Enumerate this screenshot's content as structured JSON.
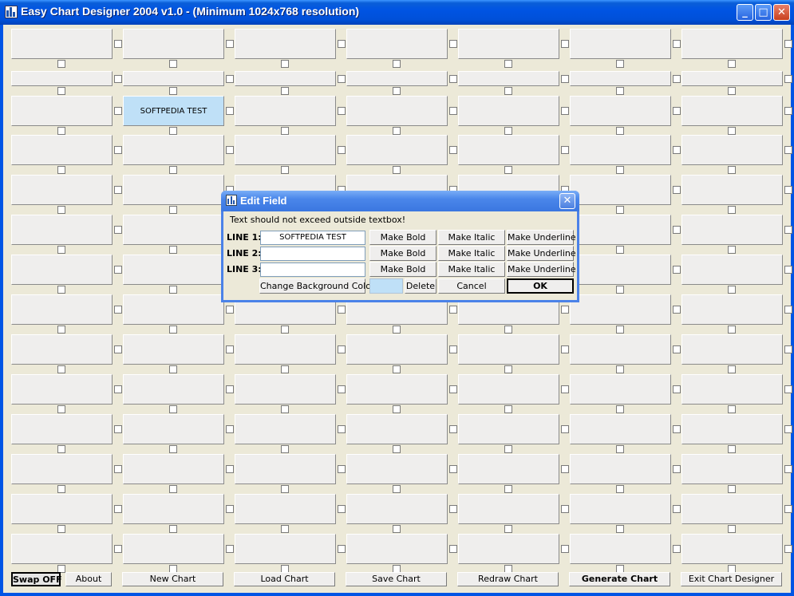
{
  "window": {
    "title": "Easy Chart Designer 2004 v1.0 - (Minimum 1024x768 resolution)",
    "controls": {
      "minimize": "_",
      "maximize": "□",
      "close": "✕"
    }
  },
  "grid": {
    "columns": 7,
    "rows": 13,
    "row_kinds": [
      "normal",
      "thin",
      "normal",
      "normal",
      "normal",
      "normal",
      "normal",
      "normal",
      "normal",
      "normal",
      "normal",
      "normal",
      "normal",
      "normal"
    ],
    "filled_cell": {
      "row": 2,
      "col": 1,
      "text": "SOFTPEDIA TEST",
      "background": "#bfe0f7"
    }
  },
  "bottom_bar": {
    "swap": "Swap OFF",
    "about": "About",
    "new_chart": "New Chart",
    "load_chart": "Load Chart",
    "save_chart": "Save Chart",
    "redraw_chart": "Redraw Chart",
    "generate_chart": "Generate Chart",
    "exit": "Exit Chart Designer"
  },
  "dialog": {
    "title": "Edit Field",
    "close": "✕",
    "message": "Text should not exceed outside textbox!",
    "lines": [
      {
        "label": "LINE 1:",
        "value": "SOFTPEDIA TEST",
        "bold": "Make Bold",
        "italic": "Make Italic",
        "underline": "Make Underline"
      },
      {
        "label": "LINE 2:",
        "value": "",
        "bold": "Make Bold",
        "italic": "Make Italic",
        "underline": "Make Underline"
      },
      {
        "label": "LINE 3:",
        "value": "",
        "bold": "Make Bold",
        "italic": "Make Italic",
        "underline": "Make Underline"
      }
    ],
    "change_bg": "Change Background Color",
    "swatch_color": "#bfe0f7",
    "delete": "Delete",
    "cancel": "Cancel",
    "ok": "OK"
  }
}
